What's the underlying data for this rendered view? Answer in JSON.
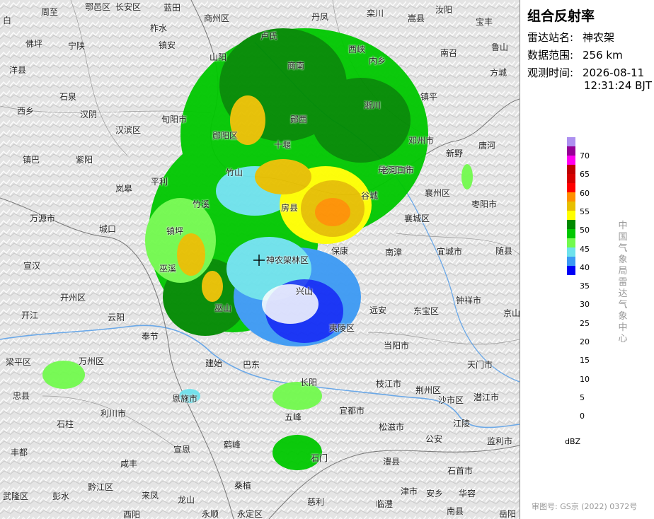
{
  "panel": {
    "title": "组合反射率",
    "station_label": "雷达站名:",
    "station_value": "神农架",
    "range_label": "数据范围:",
    "range_value": "256 km",
    "time_label": "观测时间:",
    "time_date": "2026-08-11",
    "time_clock": "12:31:24 BJT",
    "unit": "dBZ",
    "vertical_label": "中国气象局雷达气象中心",
    "review_number": "审图号: GS京 (2022) 0372号"
  },
  "legend": {
    "ticks": [
      "70",
      "65",
      "60",
      "55",
      "50",
      "45",
      "40",
      "35",
      "30",
      "25",
      "20",
      "15",
      "10",
      "5",
      "0"
    ],
    "colors": [
      "#ad90f0",
      "#960096",
      "#ff00f0",
      "#c00000",
      "#d60000",
      "#ff0000",
      "#ff9000",
      "#e7c000",
      "#ffff00",
      "#008a00",
      "#00c800",
      "#72fa4e",
      "#6ee2ec",
      "#3c9af4",
      "#0000f6"
    ]
  },
  "places": [
    "白",
    "周至",
    "鄠邑区",
    "长安区",
    "蓝田",
    "商州区",
    "丹凤",
    "栾川",
    "嵩县",
    "汝阳",
    "宝丰",
    "佛坪",
    "宁陕",
    "柞水",
    "镇安",
    "山阳",
    "卢氏",
    "西峡",
    "内乡",
    "南召",
    "鲁山",
    "洋县",
    "石泉",
    "汉阴",
    "汉滨区",
    "旬阳市",
    "郧阳区",
    "商南",
    "淅川",
    "镇平",
    "方城",
    "西乡",
    "紫阳",
    "岚皋",
    "平利",
    "竹山",
    "竹溪",
    "郧西",
    "十堰",
    "丹江口市",
    "邓州市",
    "镇巴",
    "万源市",
    "城口",
    "镇坪",
    "房县",
    "谷城",
    "老河口市",
    "襄州区",
    "新野",
    "唐河",
    "宣汉",
    "开州区",
    "巫溪",
    "巫山",
    "神农架林区",
    "保康",
    "南漳",
    "襄城区",
    "枣阳市",
    "开江",
    "云阳",
    "奉节",
    "巴东",
    "兴山",
    "远安",
    "宜城市",
    "随县",
    "钟祥市",
    "梁平区",
    "万州区",
    "忠县",
    "建始",
    "长阳",
    "夷陵区",
    "当阳市",
    "东宝区",
    "京山",
    "石柱",
    "利川市",
    "恩施市",
    "五峰",
    "宜都市",
    "枝江市",
    "荆州区",
    "沙市区",
    "潜江市",
    "天门市",
    "丰都",
    "咸丰",
    "宣恩",
    "鹤峰",
    "松滋市",
    "公安",
    "江陵",
    "监利市",
    "彭水",
    "黔江区",
    "来凤",
    "龙山",
    "桑植",
    "石门",
    "澧县",
    "津市",
    "安乡",
    "华容",
    "石首市",
    "武隆区",
    "酉阳",
    "永顺",
    "永定区",
    "慈利",
    "临澧",
    "南县",
    "岳阳"
  ]
}
